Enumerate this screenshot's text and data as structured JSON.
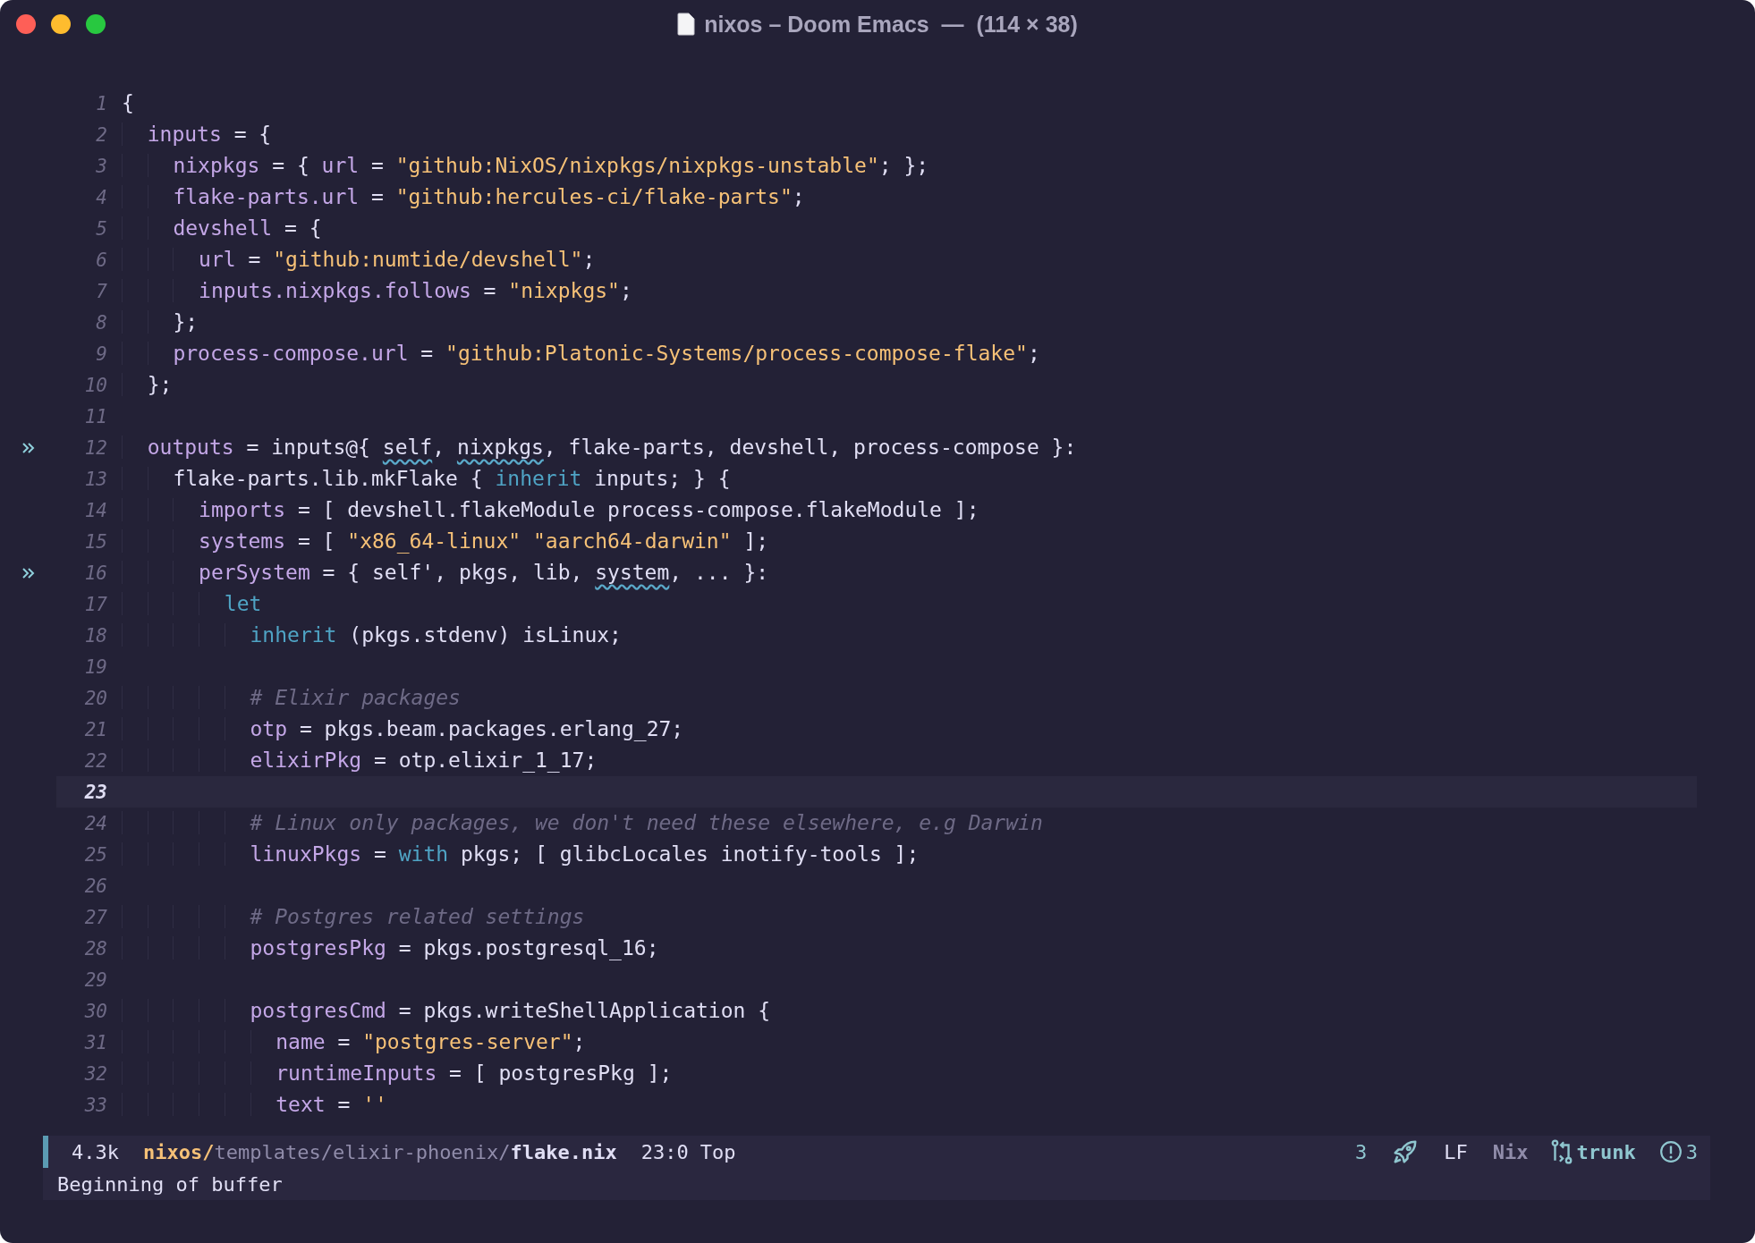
{
  "window": {
    "title": "nixos – Doom Emacs  —  (114 × 38)"
  },
  "editor": {
    "lines": [
      {
        "number": "1",
        "marker": false,
        "current": false,
        "tokens": [
          {
            "kind": "plain",
            "text": "{"
          }
        ]
      },
      {
        "number": "2",
        "marker": false,
        "current": false,
        "tokens": [
          {
            "kind": "var",
            "text": "  inputs"
          },
          {
            "kind": "plain",
            "text": " = {"
          }
        ]
      },
      {
        "number": "3",
        "marker": false,
        "current": false,
        "tokens": [
          {
            "kind": "var",
            "text": "    nixpkgs"
          },
          {
            "kind": "plain",
            "text": " = { "
          },
          {
            "kind": "var",
            "text": "url"
          },
          {
            "kind": "plain",
            "text": " = "
          },
          {
            "kind": "string",
            "text": "\"github:NixOS/nixpkgs/nixpkgs-unstable\""
          },
          {
            "kind": "plain",
            "text": "; };"
          }
        ]
      },
      {
        "number": "4",
        "marker": false,
        "current": false,
        "tokens": [
          {
            "kind": "var",
            "text": "    flake-parts.url"
          },
          {
            "kind": "plain",
            "text": " = "
          },
          {
            "kind": "string",
            "text": "\"github:hercules-ci/flake-parts\""
          },
          {
            "kind": "plain",
            "text": ";"
          }
        ]
      },
      {
        "number": "5",
        "marker": false,
        "current": false,
        "tokens": [
          {
            "kind": "var",
            "text": "    devshell"
          },
          {
            "kind": "plain",
            "text": " = {"
          }
        ]
      },
      {
        "number": "6",
        "marker": false,
        "current": false,
        "tokens": [
          {
            "kind": "var",
            "text": "      url"
          },
          {
            "kind": "plain",
            "text": " = "
          },
          {
            "kind": "string",
            "text": "\"github:numtide/devshell\""
          },
          {
            "kind": "plain",
            "text": ";"
          }
        ]
      },
      {
        "number": "7",
        "marker": false,
        "current": false,
        "tokens": [
          {
            "kind": "var",
            "text": "      inputs.nixpkgs.follows"
          },
          {
            "kind": "plain",
            "text": " = "
          },
          {
            "kind": "string",
            "text": "\"nixpkgs\""
          },
          {
            "kind": "plain",
            "text": ";"
          }
        ]
      },
      {
        "number": "8",
        "marker": false,
        "current": false,
        "tokens": [
          {
            "kind": "plain",
            "text": "    };"
          }
        ]
      },
      {
        "number": "9",
        "marker": false,
        "current": false,
        "tokens": [
          {
            "kind": "var",
            "text": "    process-compose.url"
          },
          {
            "kind": "plain",
            "text": " = "
          },
          {
            "kind": "string",
            "text": "\"github:Platonic-Systems/process-compose-flake\""
          },
          {
            "kind": "plain",
            "text": ";"
          }
        ]
      },
      {
        "number": "10",
        "marker": false,
        "current": false,
        "tokens": [
          {
            "kind": "plain",
            "text": "  };"
          }
        ]
      },
      {
        "number": "11",
        "marker": false,
        "current": false
      },
      {
        "number": "12",
        "marker": true,
        "current": false,
        "tokens": [
          {
            "kind": "var",
            "text": "  outputs"
          },
          {
            "kind": "plain",
            "text": " = inputs@{ "
          },
          {
            "kind": "warn",
            "text": "self"
          },
          {
            "kind": "plain",
            "text": ", "
          },
          {
            "kind": "warn",
            "text": "nixpkgs"
          },
          {
            "kind": "plain",
            "text": ", flake-parts, devshell, process-compose }:"
          }
        ]
      },
      {
        "number": "13",
        "marker": false,
        "current": false,
        "tokens": [
          {
            "kind": "plain",
            "text": "    flake-parts.lib.mkFlake { "
          },
          {
            "kind": "keyword",
            "text": "inherit"
          },
          {
            "kind": "plain",
            "text": " inputs; } {"
          }
        ]
      },
      {
        "number": "14",
        "marker": false,
        "current": false,
        "tokens": [
          {
            "kind": "var",
            "text": "      imports"
          },
          {
            "kind": "plain",
            "text": " = [ devshell.flakeModule process-compose.flakeModule ];"
          }
        ]
      },
      {
        "number": "15",
        "marker": false,
        "current": false,
        "tokens": [
          {
            "kind": "var",
            "text": "      systems"
          },
          {
            "kind": "plain",
            "text": " = [ "
          },
          {
            "kind": "string",
            "text": "\"x86_64-linux\" \"aarch64-darwin\""
          },
          {
            "kind": "plain",
            "text": " ];"
          }
        ]
      },
      {
        "number": "16",
        "marker": true,
        "current": false,
        "tokens": [
          {
            "kind": "var",
            "text": "      perSystem"
          },
          {
            "kind": "plain",
            "text": " = { self', pkgs, lib, "
          },
          {
            "kind": "warn",
            "text": "system"
          },
          {
            "kind": "plain",
            "text": ", ... }:"
          }
        ]
      },
      {
        "number": "17",
        "marker": false,
        "current": false,
        "tokens": [
          {
            "kind": "keyword",
            "text": "        let"
          }
        ]
      },
      {
        "number": "18",
        "marker": false,
        "current": false,
        "tokens": [
          {
            "kind": "keyword",
            "text": "          inherit"
          },
          {
            "kind": "plain",
            "text": " (pkgs.stdenv) isLinux;"
          }
        ]
      },
      {
        "number": "19",
        "marker": false,
        "current": false
      },
      {
        "number": "20",
        "marker": false,
        "current": false,
        "tokens": [
          {
            "kind": "comment",
            "text": "          # Elixir packages"
          }
        ]
      },
      {
        "number": "21",
        "marker": false,
        "current": false,
        "tokens": [
          {
            "kind": "var",
            "text": "          otp"
          },
          {
            "kind": "plain",
            "text": " = pkgs.beam.packages.erlang_27;"
          }
        ]
      },
      {
        "number": "22",
        "marker": false,
        "current": false,
        "tokens": [
          {
            "kind": "var",
            "text": "          elixirPkg"
          },
          {
            "kind": "plain",
            "text": " = otp.elixir_1_17;"
          }
        ]
      },
      {
        "number": "23",
        "marker": false,
        "current": true
      },
      {
        "number": "24",
        "marker": false,
        "current": false,
        "tokens": [
          {
            "kind": "comment",
            "text": "          # Linux only packages, we don't need these elsewhere, e.g Darwin"
          }
        ]
      },
      {
        "number": "25",
        "marker": false,
        "current": false,
        "tokens": [
          {
            "kind": "var",
            "text": "          linuxPkgs"
          },
          {
            "kind": "plain",
            "text": " = "
          },
          {
            "kind": "keyword",
            "text": "with"
          },
          {
            "kind": "plain",
            "text": " pkgs; [ glibcLocales inotify-tools ];"
          }
        ]
      },
      {
        "number": "26",
        "marker": false,
        "current": false
      },
      {
        "number": "27",
        "marker": false,
        "current": false,
        "tokens": [
          {
            "kind": "comment",
            "text": "          # Postgres related settings"
          }
        ]
      },
      {
        "number": "28",
        "marker": false,
        "current": false,
        "tokens": [
          {
            "kind": "var",
            "text": "          postgresPkg"
          },
          {
            "kind": "plain",
            "text": " = pkgs.postgresql_16;"
          }
        ]
      },
      {
        "number": "29",
        "marker": false,
        "current": false
      },
      {
        "number": "30",
        "marker": false,
        "current": false,
        "tokens": [
          {
            "kind": "var",
            "text": "          postgresCmd"
          },
          {
            "kind": "plain",
            "text": " = pkgs.writeShellApplication {"
          }
        ]
      },
      {
        "number": "31",
        "marker": false,
        "current": false,
        "tokens": [
          {
            "kind": "var",
            "text": "            name"
          },
          {
            "kind": "plain",
            "text": " = "
          },
          {
            "kind": "string",
            "text": "\"postgres-server\""
          },
          {
            "kind": "plain",
            "text": ";"
          }
        ]
      },
      {
        "number": "32",
        "marker": false,
        "current": false,
        "tokens": [
          {
            "kind": "var",
            "text": "            runtimeInputs"
          },
          {
            "kind": "plain",
            "text": " = [ postgresPkg ];"
          }
        ]
      },
      {
        "number": "33",
        "marker": false,
        "current": false,
        "tokens": [
          {
            "kind": "var",
            "text": "            text"
          },
          {
            "kind": "plain",
            "text": " = "
          },
          {
            "kind": "string",
            "text": "''"
          }
        ]
      }
    ]
  },
  "mode_line": {
    "size": "4.3k",
    "path_root": "nixos/",
    "path_dir": "templates/elixir-phoenix/",
    "file": "flake.nix",
    "position": "23:0",
    "scroll": "Top",
    "right": [
      {
        "kind": "text",
        "text": "3"
      },
      {
        "kind": "rocket"
      },
      {
        "kind": "text",
        "text": "LF"
      },
      {
        "kind": "mode",
        "text": "Nix"
      },
      {
        "kind": "branch",
        "text": "trunk"
      },
      {
        "kind": "issues",
        "text": "3"
      }
    ]
  },
  "echo_area": {
    "message": "Beginning of buffer"
  }
}
